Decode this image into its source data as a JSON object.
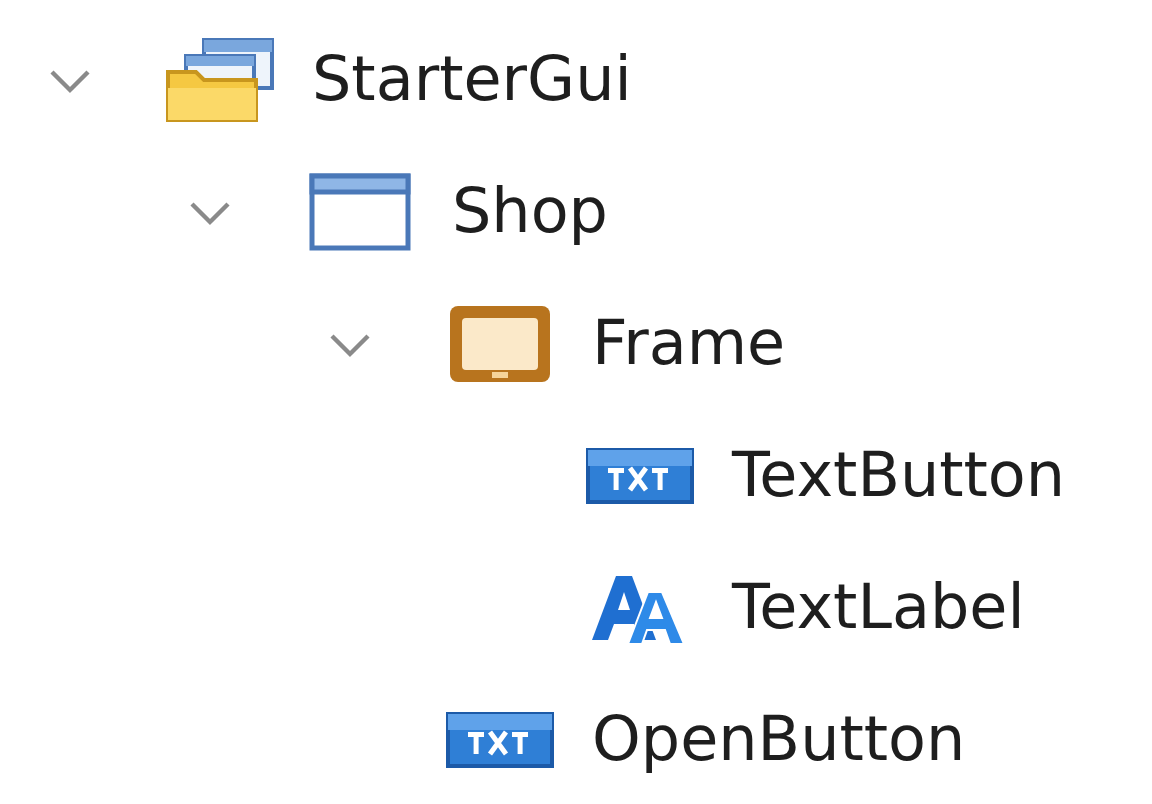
{
  "explorer": {
    "tree": [
      {
        "label": "StarterGui",
        "kind": "gui-folder",
        "expanded": true,
        "children": [
          {
            "label": "Shop",
            "kind": "screen",
            "expanded": true,
            "children": [
              {
                "label": "Frame",
                "kind": "frame",
                "expanded": true,
                "children": [
                  {
                    "label": "TextButton",
                    "kind": "text-button"
                  },
                  {
                    "label": "TextLabel",
                    "kind": "text-label"
                  }
                ]
              },
              {
                "label": "OpenButton",
                "kind": "text-button"
              }
            ]
          }
        ]
      }
    ]
  }
}
